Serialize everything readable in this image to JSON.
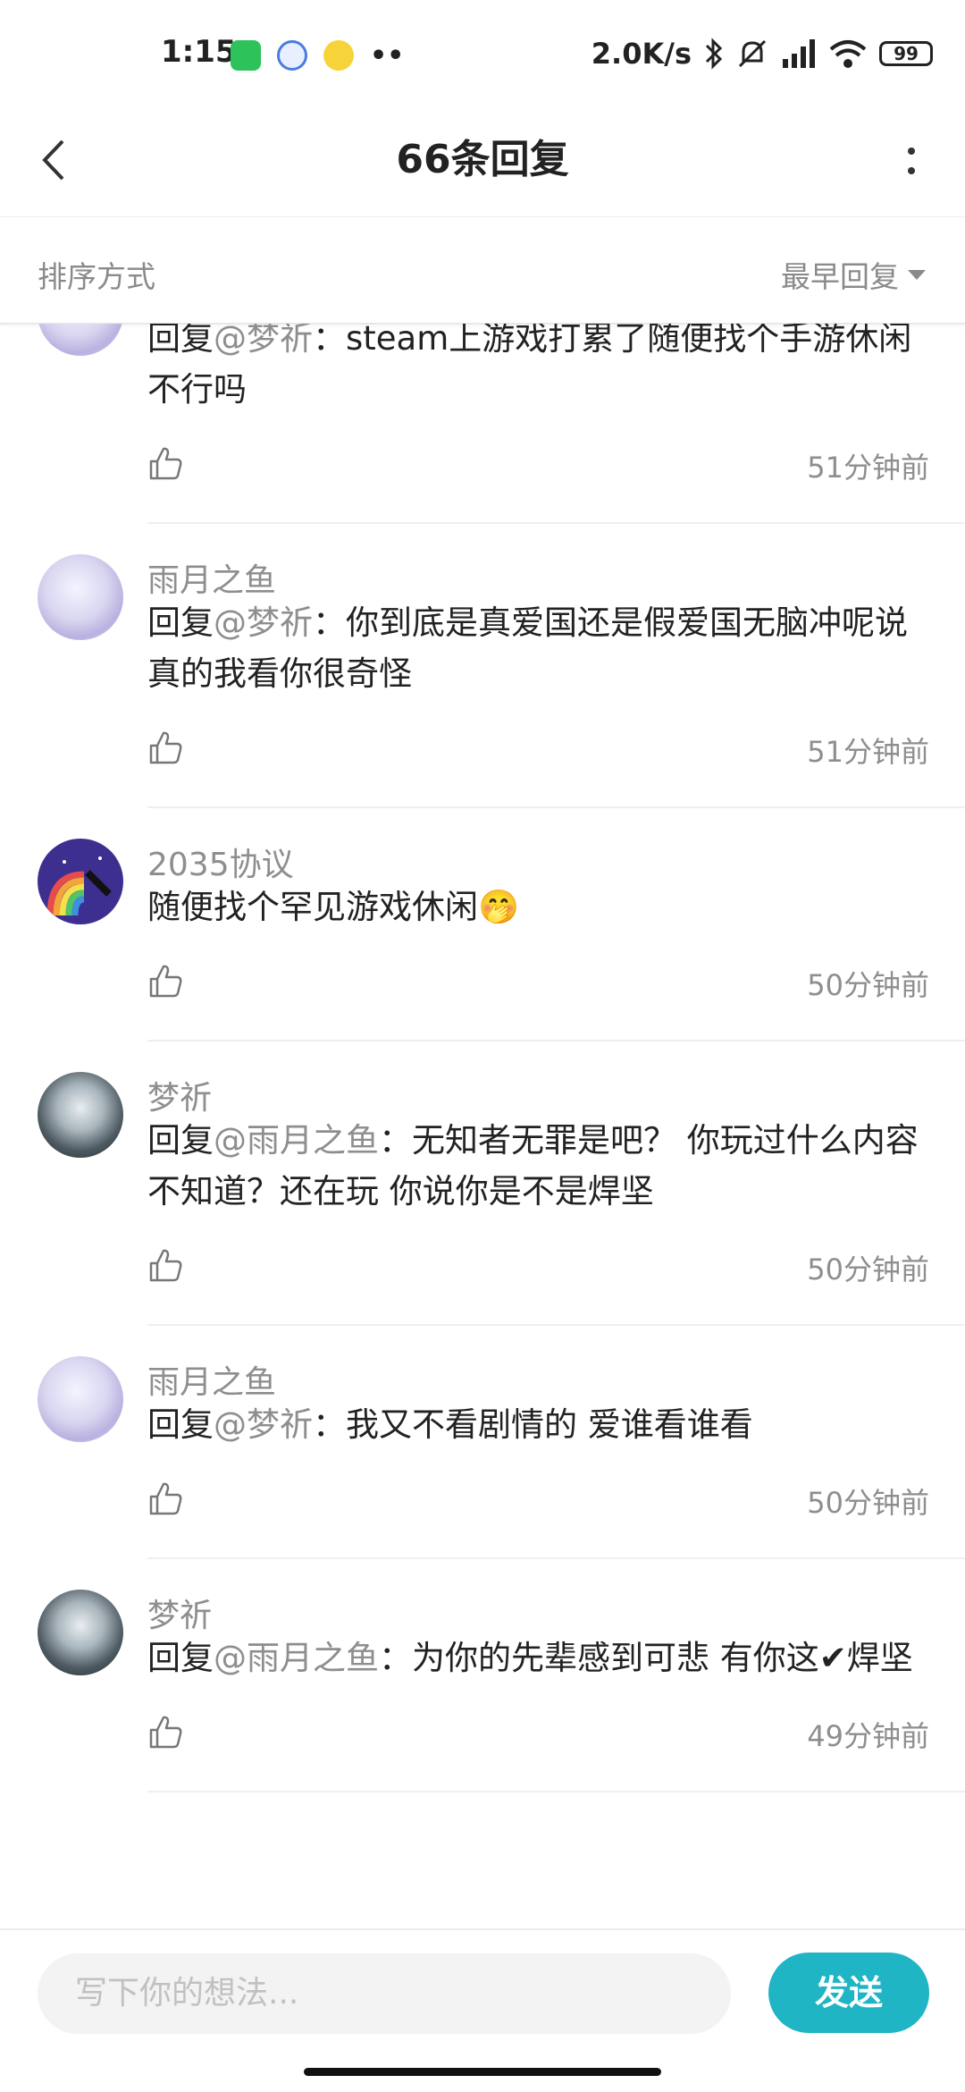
{
  "status": {
    "time": "1:15",
    "network_speed": "2.0K/s",
    "battery": "99",
    "apps": [
      "wechat-icon",
      "cloud-icon",
      "qq-music-icon",
      "more-dots"
    ],
    "icons": [
      "bluetooth-icon",
      "mute-icon",
      "signal-icon",
      "wifi-icon"
    ]
  },
  "header": {
    "title": "66条回复"
  },
  "sort": {
    "label": "排序方式",
    "selected": "最早回复"
  },
  "comments": [
    {
      "user": "",
      "reply_prefix": "回复",
      "mention": "@梦祈",
      "sep": "：",
      "text": "steam上游戏打累了随便找个手游休闲不行吗",
      "time": "51分钟前",
      "avatar": "anime-white"
    },
    {
      "user": "雨月之鱼",
      "reply_prefix": "回复",
      "mention": "@梦祈",
      "sep": "：",
      "text": "你到底是真爱国还是假爱国无脑冲呢说真的我看你很奇怪",
      "time": "51分钟前",
      "avatar": "anime-white"
    },
    {
      "user": "2035协议",
      "reply_prefix": "",
      "mention": "",
      "sep": "",
      "text": "随便找个罕见游戏休闲🤭",
      "time": "50分钟前",
      "avatar": "rainbow"
    },
    {
      "user": "梦祈",
      "reply_prefix": "回复",
      "mention": "@雨月之鱼",
      "sep": "：",
      "text": "无知者无罪是吧？ 你玩过什么内容不知道？还在玩 你说你是不是焊坚",
      "time": "50分钟前",
      "avatar": "anime-dark"
    },
    {
      "user": "雨月之鱼",
      "reply_prefix": "回复",
      "mention": "@梦祈",
      "sep": "：",
      "text": "我又不看剧情的  爱谁看谁看",
      "time": "50分钟前",
      "avatar": "anime-white"
    },
    {
      "user": "梦祈",
      "reply_prefix": "回复",
      "mention": "@雨月之鱼",
      "sep": "：",
      "text": "为你的先辈感到可悲 有你这✔焊坚",
      "time": "49分钟前",
      "avatar": "anime-dark"
    }
  ],
  "composer": {
    "placeholder": "写下你的想法...",
    "send_label": "发送"
  },
  "colors": {
    "accent": "#1fb5c4",
    "mention": "#8e8e8e"
  }
}
